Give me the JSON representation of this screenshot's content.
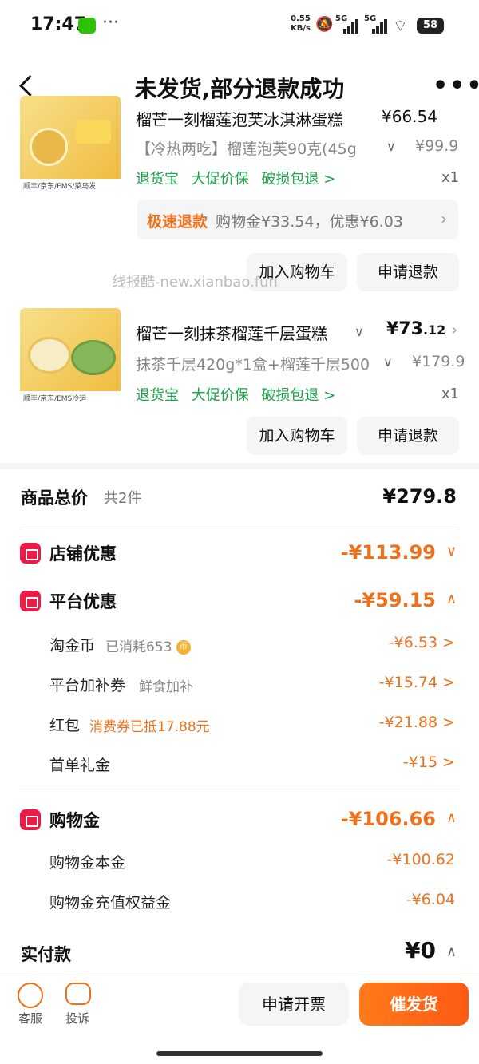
{
  "status_bar": {
    "time": "17:47",
    "dots": "···",
    "net_speed_value": "0.55",
    "net_speed_unit": "KB/s",
    "signal1": "5G",
    "signal2": "5G",
    "battery": "58"
  },
  "header": {
    "title": "未发货,部分退款成功"
  },
  "item1": {
    "name_partial": "榴芒一刻榴莲泡芙冰淇淋蛋糕",
    "price_partial": "¥66.54",
    "spec": "【冷热两吃】榴莲泡芙90克(45g",
    "orig_price": "¥99.9",
    "tags": [
      "退货宝",
      "大促价保",
      "破损包退 >"
    ],
    "qty": "x1",
    "thumb_text": "顺丰/京东/EMS/菜鸟发",
    "refund": {
      "label": "极速退款",
      "detail": "购物金¥33.54，优惠¥6.03"
    },
    "buttons": {
      "cart": "加入购物车",
      "refund": "申请退款"
    }
  },
  "watermark": "线报酷-new.xianbao.fun",
  "item2": {
    "name": "榴芒一刻抹茶榴莲千层蛋糕",
    "price_int": "¥73",
    "price_cents": ".12",
    "spec": "抹茶千层420g*1盒+榴莲千层500",
    "orig_price": "¥179.9",
    "tags": [
      "退货宝",
      "大促价保",
      "破损包退 >"
    ],
    "qty": "x1",
    "thumb_text": "顺丰/京东/EMS冷运",
    "buttons": {
      "cart": "加入购物车",
      "refund": "申请退款"
    }
  },
  "summary": {
    "total_label": "商品总价",
    "total_count": "共2件",
    "total_amount": "¥279.8",
    "shop_discount": {
      "label": "店铺优惠",
      "amount": "-¥113.99"
    },
    "platform_discount": {
      "label": "平台优惠",
      "amount": "-¥59.15",
      "items": [
        {
          "label": "淘金币",
          "note": "已消耗653",
          "amount": "-¥6.53 >"
        },
        {
          "label": "平台加补券",
          "note": "鲜食加补",
          "amount": "-¥15.74 >"
        },
        {
          "label": "红包",
          "note": "消费券已抵17.88元",
          "amount": "-¥21.88 >"
        },
        {
          "label": "首单礼金",
          "note": "",
          "amount": "-¥15 >"
        }
      ]
    },
    "shopping_gold": {
      "label": "购物金",
      "amount": "-¥106.66",
      "items": [
        {
          "label": "购物金本金",
          "amount": "-¥100.62"
        },
        {
          "label": "购物金充值权益金",
          "amount": "-¥6.04"
        }
      ]
    },
    "paid_label": "实付款",
    "paid_amount": "¥0"
  },
  "bottom_bar": {
    "service": "客服",
    "complain": "投诉",
    "invoice_btn": "申请开票",
    "urge_btn": "催发货"
  },
  "colors": {
    "accent_orange": "#f0711c",
    "green_tag": "#1aa34a",
    "red_icon": "#ee1b46",
    "urge_gradient": "#ff5a14"
  }
}
